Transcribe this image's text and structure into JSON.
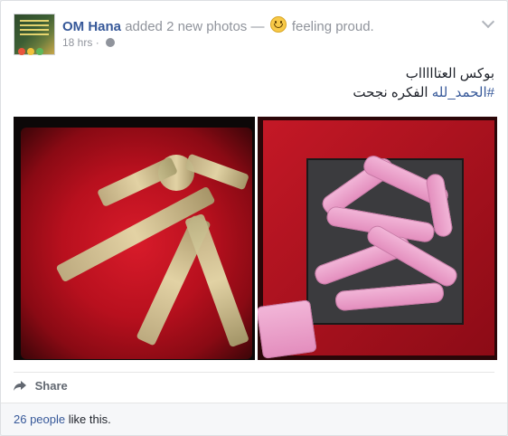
{
  "post": {
    "author": "OM Hana",
    "action": "added 2 new photos",
    "separator": "—",
    "feeling": "feeling proud.",
    "time": "18 hrs",
    "text_line1": "بوكس العتاااااب",
    "hashtag": "#الحمد_لله",
    "text_line2_rest": " الفكره نجحت"
  },
  "actions": {
    "share_label": "Share"
  },
  "likes": {
    "count_link": "26 people",
    "suffix": " like this."
  },
  "colors": {
    "link": "#365899",
    "meta": "#90949c"
  }
}
